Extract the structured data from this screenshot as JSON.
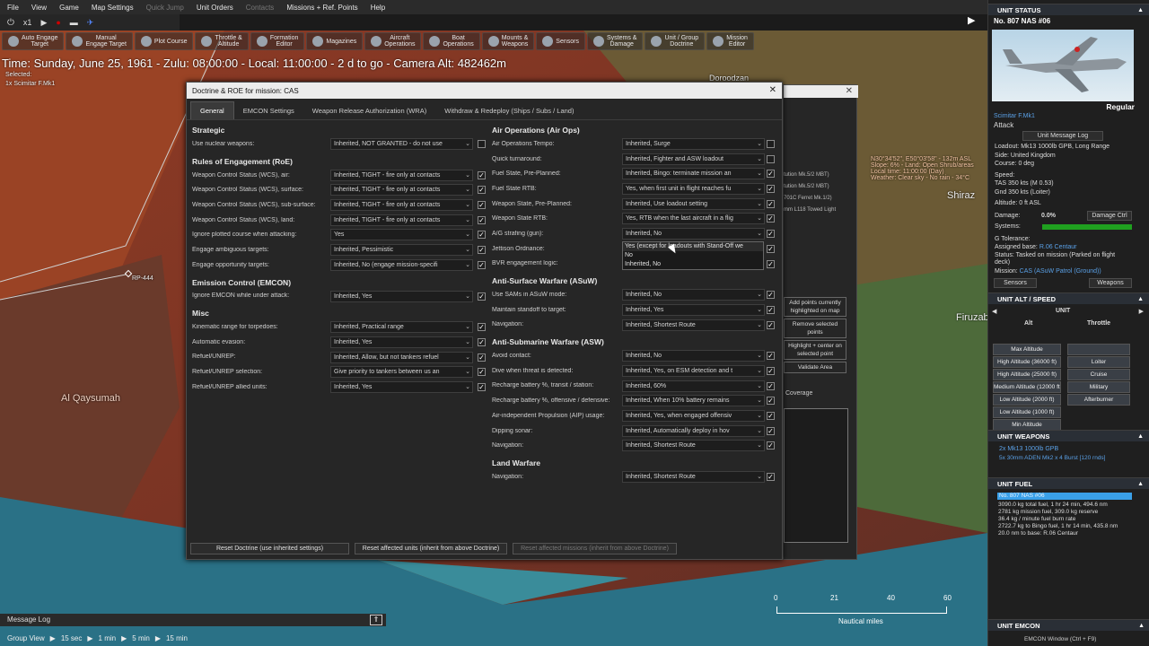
{
  "menu": [
    "File",
    "View",
    "Game",
    "Map Settings",
    "Quick Jump",
    "Unit Orders",
    "Contacts",
    "Missions + Ref. Points",
    "Help"
  ],
  "menu_disabled": [
    "Quick Jump",
    "Contacts"
  ],
  "controls": {
    "speed": "x1"
  },
  "toolbar": [
    {
      "label": "Auto Engage\nTarget",
      "icon": "auto-engage-icon"
    },
    {
      "label": "Manual\nEngage Target",
      "icon": "manual-engage-icon"
    },
    {
      "label": "Plot Course",
      "icon": "plot-course-icon"
    },
    {
      "label": "Throttle &\nAltitude",
      "icon": "throttle-icon"
    },
    {
      "label": "Formation\nEditor",
      "icon": "formation-icon"
    },
    {
      "label": "Magazines",
      "icon": "magazines-icon"
    },
    {
      "label": "Aircraft\nOperations",
      "icon": "aircraft-icon"
    },
    {
      "label": "Boat\nOperations",
      "icon": "boat-icon"
    },
    {
      "label": "Mounts &\nWeapons",
      "icon": "mounts-icon"
    },
    {
      "label": "Sensors",
      "icon": "sensors-icon"
    },
    {
      "label": "Systems &\nDamage",
      "icon": "systems-icon"
    },
    {
      "label": "Unit / Group\nDoctrine",
      "icon": "doctrine-icon"
    },
    {
      "label": "Mission\nEditor",
      "icon": "mission-editor-icon"
    }
  ],
  "time_line": "Time: Sunday, June 25, 1961 - Zulu: 08:00:00 - Local: 11:00:00 - 2 d to go -  Camera Alt: 482462m",
  "map": {
    "selected": "Selected:",
    "selected_unit": "1x Scimitar F.Mk1",
    "labels": {
      "rp": "RP-444",
      "al_qaysumah": "Al Qaysumah",
      "doroodzan": "Doroodzan",
      "firuzab": "Firuzab",
      "shiraz": "Shiraz"
    },
    "info": [
      "N30°34'52\", E50°03'58\" - 132m ASL",
      "Slope: 6% - Land: Open Shrub/areas",
      "Local time: 11:00:00 (Day)",
      "Weather: Clear sky - No rain - 34°C"
    ]
  },
  "dialog": {
    "title": "Doctrine & ROE for mission: CAS",
    "tabs": [
      "General",
      "EMCON Settings",
      "Weapon Release Authorization (WRA)",
      "Withdraw & Redeploy (Ships / Subs / Land)"
    ],
    "left": [
      {
        "section": "Strategic"
      },
      {
        "label": "Use nuclear weapons:",
        "value": "Inherited, NOT GRANTED - do not use",
        "check": false
      },
      {
        "section": "Rules of Engagement (RoE)"
      },
      {
        "label": "Weapon Control Status (WCS), air:",
        "value": "Inherited, TIGHT - fire only at contacts",
        "check": true
      },
      {
        "label": "Weapon Control Status (WCS), surface:",
        "value": "Inherited, TIGHT - fire only at contacts",
        "check": true
      },
      {
        "label": "Weapon Control Status (WCS), sub-surface:",
        "value": "Inherited, TIGHT - fire only at contacts",
        "check": true
      },
      {
        "label": "Weapon Control Status (WCS), land:",
        "value": "Inherited, TIGHT - fire only at contacts",
        "check": true
      },
      {
        "label": "Ignore plotted course when attacking:",
        "value": "Yes",
        "check": true
      },
      {
        "label": "Engage ambiguous targets:",
        "value": "Inherited, Pessimistic",
        "check": true
      },
      {
        "label": "Engage opportunity targets:",
        "value": "Inherited, No (engage mission-specifi",
        "check": true
      },
      {
        "section": "Emission Control (EMCON)"
      },
      {
        "label": "Ignore EMCON while under attack:",
        "value": "Inherited, Yes",
        "check": true
      },
      {
        "section": "Misc"
      },
      {
        "label": "Kinematic range for torpedoes:",
        "value": "Inherited, Practical range",
        "check": true
      },
      {
        "label": "Automatic evasion:",
        "value": "Inherited, Yes",
        "check": true
      },
      {
        "label": "Refuel/UNREP:",
        "value": "Inherited, Allow, but not tankers refuel",
        "check": true
      },
      {
        "label": "Refuel/UNREP selection:",
        "value": "Give priority to tankers between us an",
        "check": true
      },
      {
        "label": "Refuel/UNREP allied units:",
        "value": "Inherited, Yes",
        "check": true
      }
    ],
    "right": [
      {
        "section": "Air Operations (Air Ops)"
      },
      {
        "label": "Air Operations Tempo:",
        "value": "Inherited, Surge",
        "check": false
      },
      {
        "label": "Quick turnaround:",
        "value": "Inherited, Fighter and ASW loadout",
        "check": false
      },
      {
        "label": "Fuel State, Pre-Planned:",
        "value": "Inherited, Bingo: terminate mission an",
        "check": true
      },
      {
        "label": "Fuel State RTB:",
        "value": "Yes, when first unit in flight reaches fu",
        "check": true
      },
      {
        "label": "Weapon State, Pre-Planned:",
        "value": "Inherited, Use loadout setting",
        "check": true
      },
      {
        "label": "Weapon State RTB:",
        "value": "Yes, RTB when the last aircraft in a flig",
        "check": true
      },
      {
        "label": "A/G strafing (gun):",
        "value": "Inherited, No",
        "check": true
      },
      {
        "label": "Jettison Ordnance:",
        "value": "",
        "check": true
      },
      {
        "label": "BVR engagement logic:",
        "value": "",
        "check": true
      },
      {
        "section": "Anti-Surface Warfare (ASuW)"
      },
      {
        "label": "Use SAMs in ASuW mode:",
        "value": "Inherited, No",
        "check": true
      },
      {
        "label": "Maintain standoff to target:",
        "value": "Inherited, Yes",
        "check": true
      },
      {
        "label": "Navigation:",
        "value": "Inherited, Shortest Route",
        "check": true
      },
      {
        "section": "Anti-Submarine Warfare (ASW)"
      },
      {
        "label": "Avoid contact:",
        "value": "Inherited, No",
        "check": true
      },
      {
        "label": "Dive when threat is detected:",
        "value": "Inherited, Yes, on ESM detection and t",
        "check": true
      },
      {
        "label": "Recharge battery %, transit / station:",
        "value": "Inherited, 60%",
        "check": true
      },
      {
        "label": "Recharge battery %, offensive / defensive:",
        "value": "Inherited, When 10% battery remains",
        "check": true
      },
      {
        "label": "Air-independent Propulsion (AIP) usage:",
        "value": "Inherited, Yes, when engaged offensiv",
        "check": true
      },
      {
        "label": "Dipping sonar:",
        "value": "Inherited, Automatically deploy in hov",
        "check": true
      },
      {
        "label": "Navigation:",
        "value": "Inherited, Shortest Route",
        "check": true
      },
      {
        "section": "Land Warfare"
      },
      {
        "label": "Navigation:",
        "value": "Inherited, Shortest Route",
        "check": true
      }
    ],
    "dropdown_options": [
      "Yes (except for loadouts with Stand-Off we",
      "No",
      "Inherited, No"
    ],
    "footer": {
      "reset_doctrine": "Reset Doctrine (use inherited settings)",
      "reset_units": "Reset affected units (inherit from above Doctrine)",
      "reset_missions": "Reset affected missions (inherit from above Doctrine)"
    }
  },
  "behind_panel": {
    "items": [
      "Add points currently highlighted on map",
      "Remove selected points",
      "Highlight + center on selected point",
      "Validate Area"
    ],
    "coverage": "Coverage",
    "lines": [
      "tution Mk.5/2 MBT)",
      "tution Mk.5/2 MBT)",
      "701C Ferret Mk.1/2)",
      "mm L118 Towed Light"
    ]
  },
  "unit_status": {
    "header": "UNIT STATUS",
    "name": "No. 807 NAS #06",
    "proficiency": "Regular",
    "type": "Scimitar F.Mk1",
    "role": "Attack",
    "msg_log": "Unit Message Log",
    "loadout": "Loadout: Mk13 1000lb GPB, Long Range",
    "side": "Side: United Kingdom",
    "course": "Course: 0 deg",
    "speed_label": "Speed:",
    "tas": "TAS 350 kts (M 0.53)",
    "gnd": "Gnd 350 kts (Loiter)",
    "altitude": "Altitude: 0 ft ASL",
    "damage_label": "Damage:",
    "damage": "0.0%",
    "damage_btn": "Damage Ctrl",
    "systems": "Systems:",
    "systems_pct": 1.0,
    "g_tol": "G Tolerance:",
    "assigned": "Assigned base:",
    "assigned_val": "R.06 Centaur",
    "status": "Status: Tasked on mission (Parked on flight deck)",
    "mission": "Mission:",
    "mission_val": "CAS (ASuW Patrol (Ground))",
    "sensors": "Sensors",
    "weapons": "Weapons"
  },
  "alt_speed": {
    "header": "UNIT ALT / SPEED",
    "unit": "UNIT",
    "alt": "Alt",
    "throttle": "Throttle",
    "alt_buttons": [
      "Max Altitude",
      "High Altitude (36000 ft)",
      "High Altitude (25000 ft)",
      "Medium Altitude (12000 ft)",
      "Low Altitude (2000 ft)",
      "Low Altitude (1000 ft)",
      "Min Altitude"
    ],
    "speed_buttons": [
      "",
      "Loiter",
      "Cruise",
      "Military",
      "Afterburner"
    ]
  },
  "unit_weapons": {
    "header": "UNIT WEAPONS",
    "items": [
      "2x Mk13 1000lb GPB",
      "5x 30mm ADEN Mk2 x 4 Burst [120 rnds]"
    ]
  },
  "unit_fuel": {
    "header": "UNIT FUEL",
    "bar": "No. 807 NAS #06",
    "lines": [
      "3090.0 kg total fuel, 1 hr 24 min, 494.6 nm",
      "2781 kg mission fuel, 309.0 kg reserve",
      "36.4 kg / minute fuel burn rate",
      "2722.7 kg to Bingo fuel, 1 hr 14 min, 435.8 nm",
      "20.0 nm to base: R.06 Centaur"
    ]
  },
  "unit_emcon": {
    "header": "UNIT EMCON",
    "sub": "EMCON Window (Ctrl + F9)"
  },
  "bottom": {
    "message_log": "Message Log",
    "group_view": "Group View",
    "steps": [
      "15 sec",
      "1 min",
      "5 min",
      "15 min"
    ]
  },
  "scale": {
    "ticks": [
      "0",
      "21",
      "40",
      "60"
    ],
    "unit": "Nautical miles"
  },
  "colors": {
    "map_land": "#8a3a2a",
    "map_sea": "#2c7a8a",
    "dialog_bg": "#262626",
    "accent": "#5aa0e6",
    "fuel_bar": "#3aa0e8",
    "systems_bar": "#1fa01f"
  }
}
